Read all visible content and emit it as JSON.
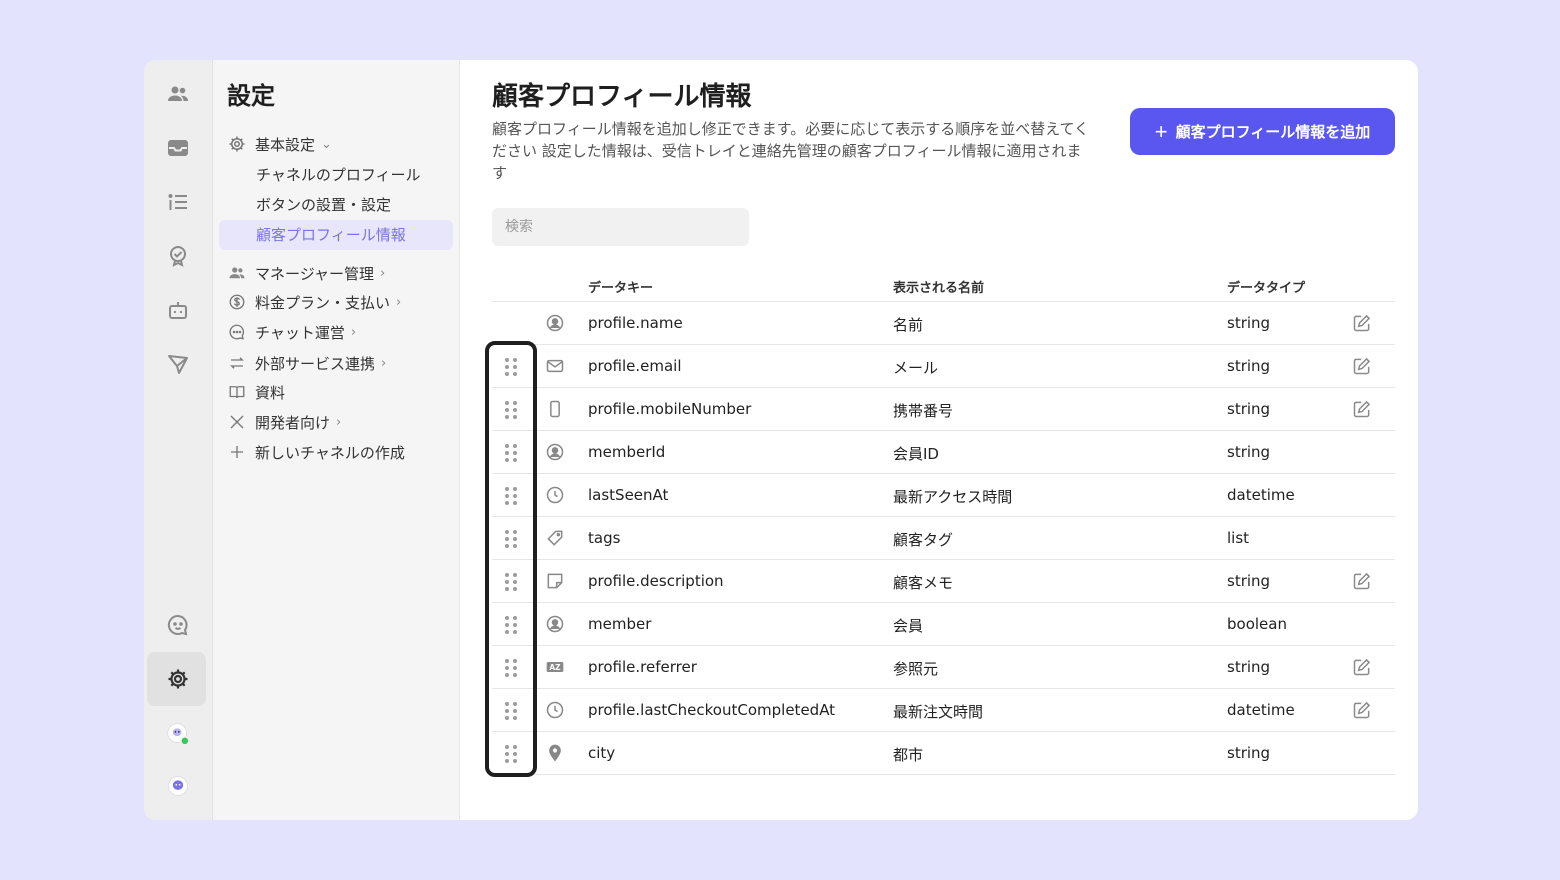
{
  "sidebar": {
    "title": "設定",
    "items": [
      {
        "label": "基本設定",
        "icon": "gear-icon",
        "chevron": "down"
      },
      {
        "label": "マネージャー管理",
        "icon": "users-icon",
        "chevron": "right"
      },
      {
        "label": "料金プラン・支払い",
        "icon": "dollar-icon",
        "chevron": "right"
      },
      {
        "label": "チャット運営",
        "icon": "chat-icon",
        "chevron": "right"
      },
      {
        "label": "外部サービス連携",
        "icon": "swap-icon",
        "chevron": "right"
      },
      {
        "label": "資料",
        "icon": "book-icon"
      },
      {
        "label": "開発者向け",
        "icon": "tools-icon",
        "chevron": "right"
      },
      {
        "label": "新しいチャネルの作成",
        "icon": "plus-icon"
      }
    ],
    "sub_items": [
      {
        "label": "チャネルのプロフィール"
      },
      {
        "label": "ボタンの設置・設定"
      },
      {
        "label": "顧客プロフィール情報",
        "active": true
      }
    ]
  },
  "main": {
    "title": "顧客プロフィール情報",
    "description": "顧客プロフィール情報を追加し修正できます。必要に応じて表示する順序を並べ替えてください 設定した情報は、受信トレイと連絡先管理の顧客プロフィール情報に適用されます",
    "add_button": "顧客プロフィール情報を追加",
    "search_placeholder": "検索",
    "columns": {
      "key": "データキー",
      "name": "表示される名前",
      "type": "データタイプ"
    },
    "rows": [
      {
        "key": "profile.name",
        "name": "名前",
        "type": "string",
        "icon": "person-circle-icon",
        "draggable": false,
        "editable": true
      },
      {
        "key": "profile.email",
        "name": "メール",
        "type": "string",
        "icon": "mail-icon",
        "draggable": true,
        "editable": true
      },
      {
        "key": "profile.mobileNumber",
        "name": "携帯番号",
        "type": "string",
        "icon": "phone-icon",
        "draggable": true,
        "editable": true
      },
      {
        "key": "memberId",
        "name": "会員ID",
        "type": "string",
        "icon": "person-circle-icon",
        "draggable": true,
        "editable": false
      },
      {
        "key": "lastSeenAt",
        "name": "最新アクセス時間",
        "type": "datetime",
        "icon": "clock-icon",
        "draggable": true,
        "editable": false
      },
      {
        "key": "tags",
        "name": "顧客タグ",
        "type": "list",
        "icon": "tag-icon",
        "draggable": true,
        "editable": false
      },
      {
        "key": "profile.description",
        "name": "顧客メモ",
        "type": "string",
        "icon": "note-icon",
        "draggable": true,
        "editable": true
      },
      {
        "key": "member",
        "name": "会員",
        "type": "boolean",
        "icon": "person-circle-icon",
        "draggable": true,
        "editable": false
      },
      {
        "key": "profile.referrer",
        "name": "参照元",
        "type": "string",
        "icon": "az-icon",
        "draggable": true,
        "editable": true
      },
      {
        "key": "profile.lastCheckoutCompletedAt",
        "name": "最新注文時間",
        "type": "datetime",
        "icon": "clock-icon",
        "draggable": true,
        "editable": true
      },
      {
        "key": "city",
        "name": "都市",
        "type": "string",
        "icon": "pin-icon",
        "draggable": true,
        "editable": false
      }
    ]
  },
  "colors": {
    "accent": "#5a57f0",
    "active_menu_text": "#7a72e8",
    "background": "#e4e3fe"
  }
}
